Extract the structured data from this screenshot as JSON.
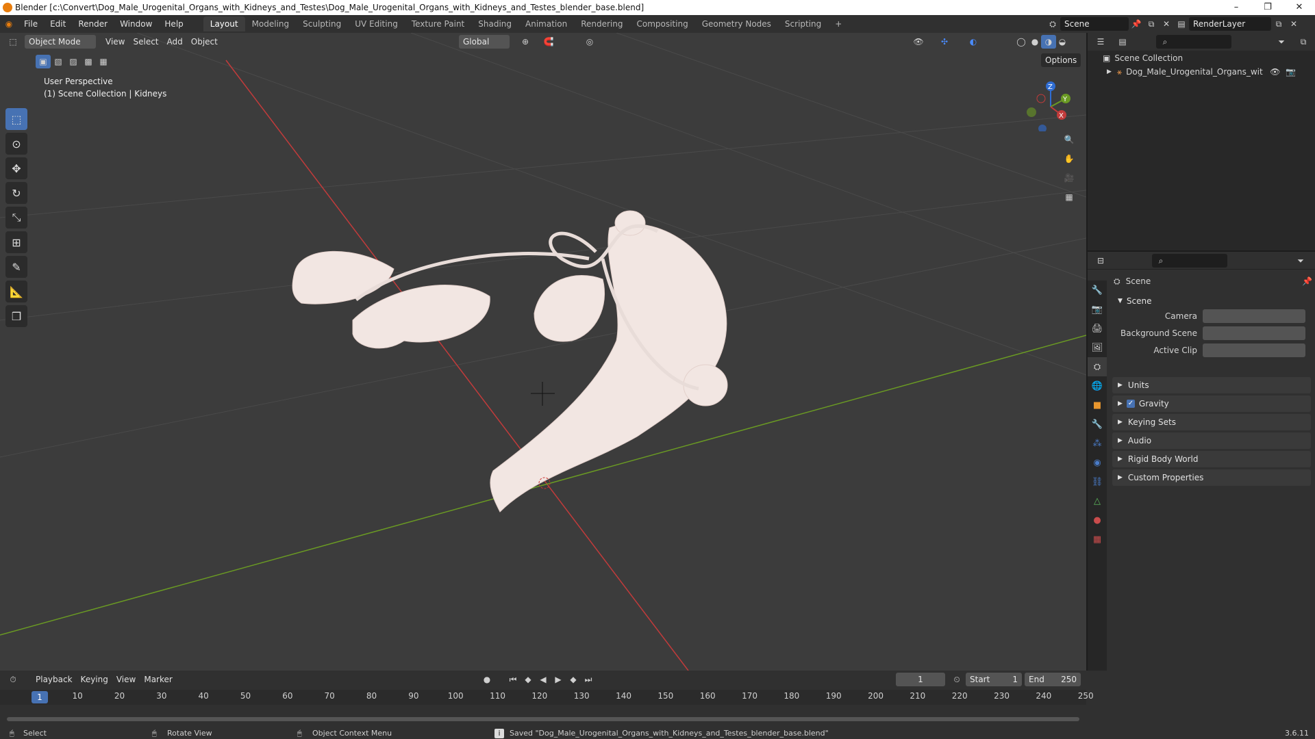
{
  "window": {
    "title": "Blender [c:\\Convert\\Dog_Male_Urogenital_Organs_with_Kidneys_and_Testes\\Dog_Male_Urogenital_Organs_with_Kidneys_and_Testes_blender_base.blend]",
    "minimize": "–",
    "maximize": "❐",
    "close": "✕"
  },
  "menus": [
    "File",
    "Edit",
    "Render",
    "Window",
    "Help"
  ],
  "workspaces": [
    "Layout",
    "Modeling",
    "Sculpting",
    "UV Editing",
    "Texture Paint",
    "Shading",
    "Animation",
    "Rendering",
    "Compositing",
    "Geometry Nodes",
    "Scripting",
    "+"
  ],
  "scene_selector": "Scene",
  "view_layer": "RenderLayer",
  "viewport": {
    "mode": "Object Mode",
    "menus": [
      "View",
      "Select",
      "Add",
      "Object"
    ],
    "orientation": "Global",
    "options": "Options",
    "info_line1": "User Perspective",
    "info_line2": "(1) Scene Collection | Kidneys",
    "gizmo": {
      "x": "X",
      "y": "Y",
      "z": "Z"
    }
  },
  "outliner": {
    "root": "Scene Collection",
    "item": "Dog_Male_Urogenital_Organs_with_Kidr"
  },
  "properties": {
    "context": "Scene",
    "section": "Scene",
    "fields": [
      {
        "label": "Camera"
      },
      {
        "label": "Background Scene"
      },
      {
        "label": "Active Clip"
      }
    ],
    "panels": [
      "Units",
      "Gravity",
      "Keying Sets",
      "Audio",
      "Rigid Body World",
      "Custom Properties"
    ]
  },
  "timeline": {
    "menus": [
      "Playback",
      "Keying",
      "View",
      "Marker"
    ],
    "current_frame": "1",
    "start_label": "Start",
    "start": "1",
    "end_label": "End",
    "end": "250",
    "ticks": [
      "10",
      "20",
      "30",
      "40",
      "50",
      "60",
      "70",
      "80",
      "90",
      "100",
      "110",
      "120",
      "130",
      "140",
      "150",
      "160",
      "170",
      "180",
      "190",
      "200",
      "210",
      "220",
      "230",
      "240",
      "250"
    ],
    "frame_marker": "1"
  },
  "status": {
    "select": "Select",
    "rotate": "Rotate View",
    "context": "Object Context Menu",
    "message": "Saved \"Dog_Male_Urogenital_Organs_with_Kidneys_and_Testes_blender_base.blend\"",
    "version": "3.6.11"
  },
  "colors": {
    "accent": "#4772b3",
    "x_axis": "#c23b3b",
    "y_axis": "#6a9a23",
    "z_axis": "#2f6dd3",
    "model": "#f2e6e2"
  }
}
